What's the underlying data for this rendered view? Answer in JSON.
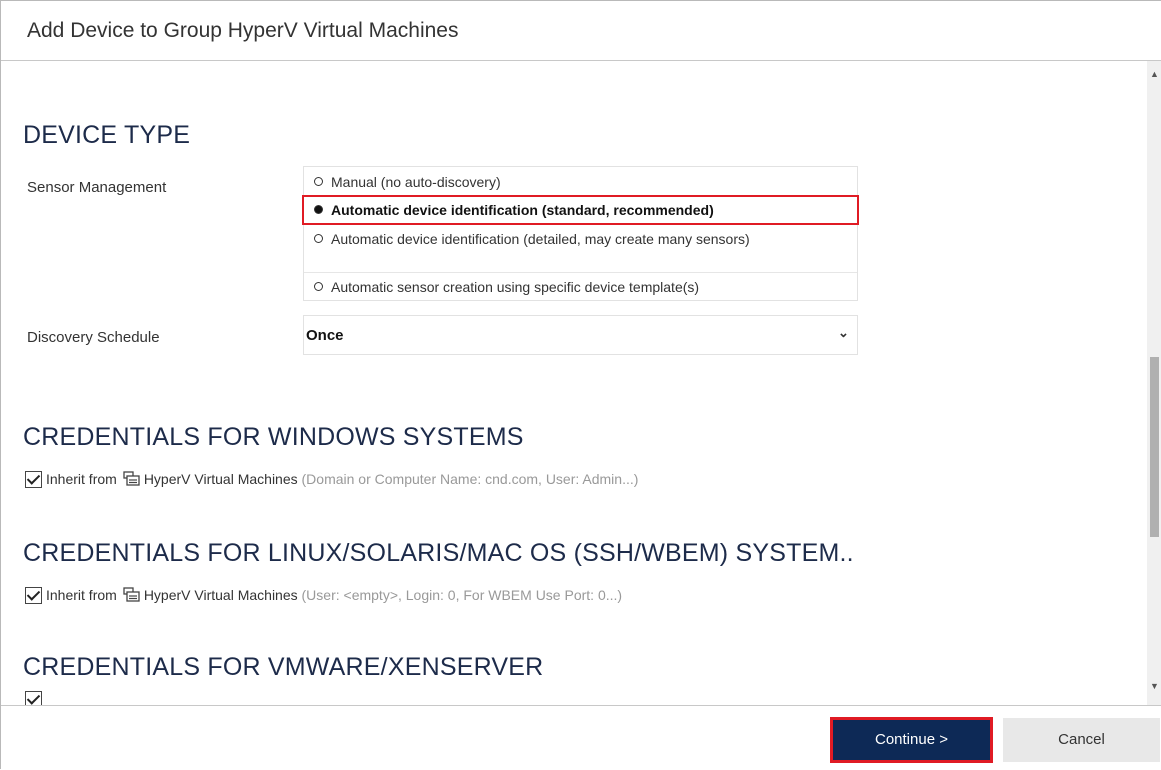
{
  "dialog": {
    "title": "Add Device to Group HyperV Virtual Machines"
  },
  "device_type": {
    "heading": "DEVICE TYPE",
    "sensor_management": {
      "label": "Sensor Management",
      "options": [
        "Manual (no auto-discovery)",
        "Automatic device identification (standard, recommended)",
        "Automatic device identification (detailed, may create many sensors)",
        "Automatic sensor creation using specific device template(s)"
      ],
      "selected_index": 1
    },
    "discovery_schedule": {
      "label": "Discovery Schedule",
      "value": "Once"
    }
  },
  "windows": {
    "heading": "CREDENTIALS FOR WINDOWS SYSTEMS",
    "inherit_prefix": "Inherit from",
    "group_name": "HyperV Virtual Machines",
    "details": "(Domain or Computer Name: cnd.com, User: Admin...)"
  },
  "linux": {
    "heading": "CREDENTIALS FOR LINUX/SOLARIS/MAC OS (SSH/WBEM) SYSTEM..",
    "inherit_prefix": "Inherit from",
    "group_name": "HyperV Virtual Machines",
    "details": "(User: <empty>, Login: 0, For WBEM Use Port: 0...)"
  },
  "vmware": {
    "heading": "CREDENTIALS FOR VMWARE/XENSERVER"
  },
  "footer": {
    "continue_label": "Continue >",
    "cancel_label": "Cancel"
  },
  "colors": {
    "primary_button": "#0d2956",
    "highlight": "#e01b24",
    "heading": "#1d2b4a"
  }
}
